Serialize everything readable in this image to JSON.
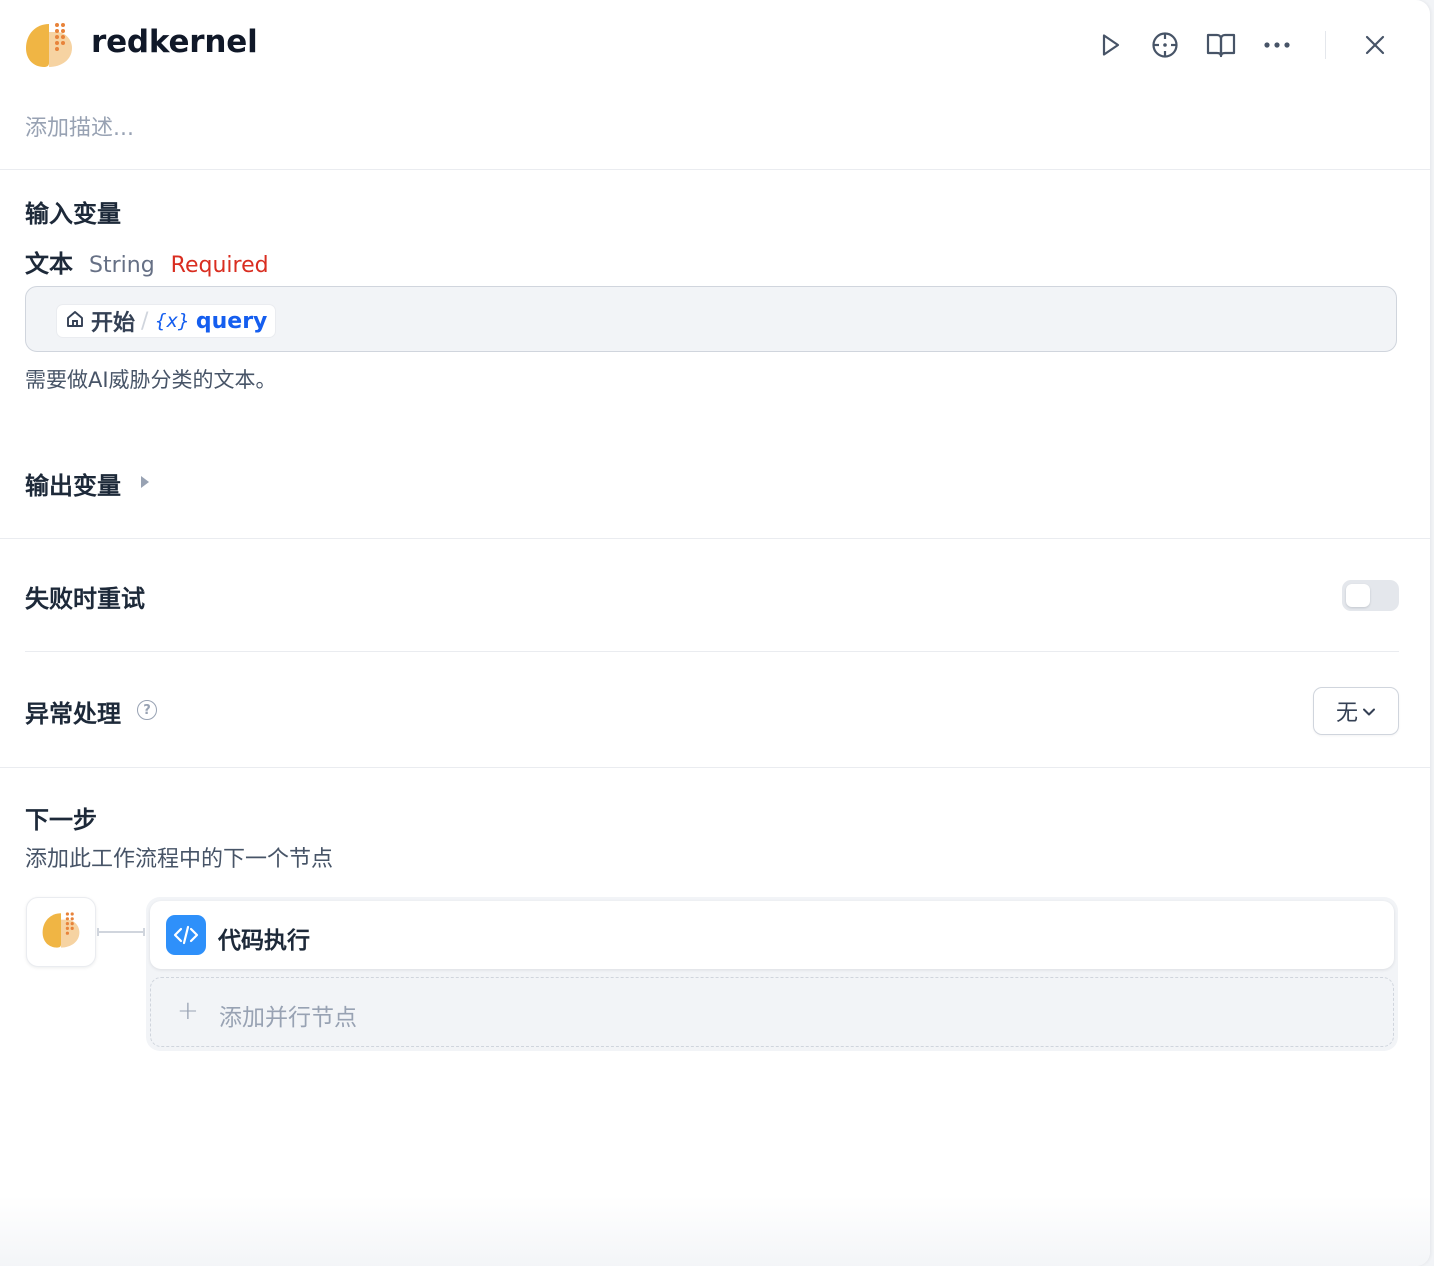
{
  "header": {
    "title": "redkernel",
    "description_placeholder": "添加描述...",
    "icons": [
      "run-icon",
      "crosshair-icon",
      "book-icon",
      "more-icon",
      "close-icon"
    ]
  },
  "input_section": {
    "title": "输入变量",
    "variable": {
      "name": "文本",
      "type": "String",
      "required": "Required",
      "source_node": "开始",
      "separator": "/",
      "var_icon": "{x}",
      "var_name": "query",
      "description": "需要做AI威胁分类的文本。"
    }
  },
  "output_section": {
    "title": "输出变量"
  },
  "retry_section": {
    "title": "失败时重试",
    "enabled": false
  },
  "error_section": {
    "title": "异常处理",
    "help": "?",
    "selected": "无"
  },
  "next_section": {
    "title": "下一步",
    "subtitle": "添加此工作流程中的下一个节点",
    "next_node": "代码执行",
    "add_parallel": "添加并行节点",
    "add_symbol": "+"
  },
  "colors": {
    "logo_primary": "#f0b544",
    "logo_secondary": "#f6d3a2",
    "logo_dots": "#e8833a",
    "required": "#d92d20",
    "variable": "#155eef",
    "code_icon_bg": "#2e90fa"
  }
}
